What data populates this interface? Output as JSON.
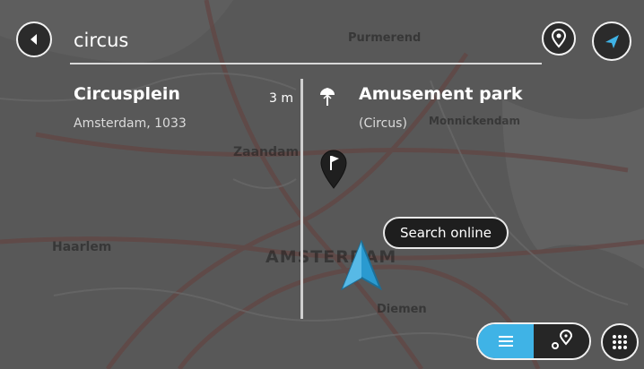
{
  "search": {
    "query": "circus"
  },
  "results": [
    {
      "title": "Circusplein",
      "subtitle": "Amsterdam, 1033",
      "distance": "3 m"
    },
    {
      "title": "Amusement park",
      "subtitle": "(Circus)"
    }
  ],
  "actions": {
    "search_online_label": "Search online"
  },
  "map_labels": {
    "zaandam": "Zaandam",
    "amsterdam": "AMSTERDAM",
    "haarlem": "Haarlem",
    "purmerend": "Purmerend",
    "diemen": "Diemen",
    "monnickendam": "Monnickendam"
  },
  "icons": {
    "back": "back-arrow-icon",
    "poi": "poi-pin-icon",
    "nav": "navigation-arrow-icon",
    "amusement": "amusement-park-icon",
    "flag_pin": "flag-pin-icon",
    "list": "list-view-icon",
    "map": "map-view-icon",
    "keyboard": "keyboard-icon",
    "position": "current-position-arrow-icon"
  },
  "colors": {
    "accent": "#3fb3e6",
    "dark": "#262626",
    "position": "#2a9ad0"
  }
}
